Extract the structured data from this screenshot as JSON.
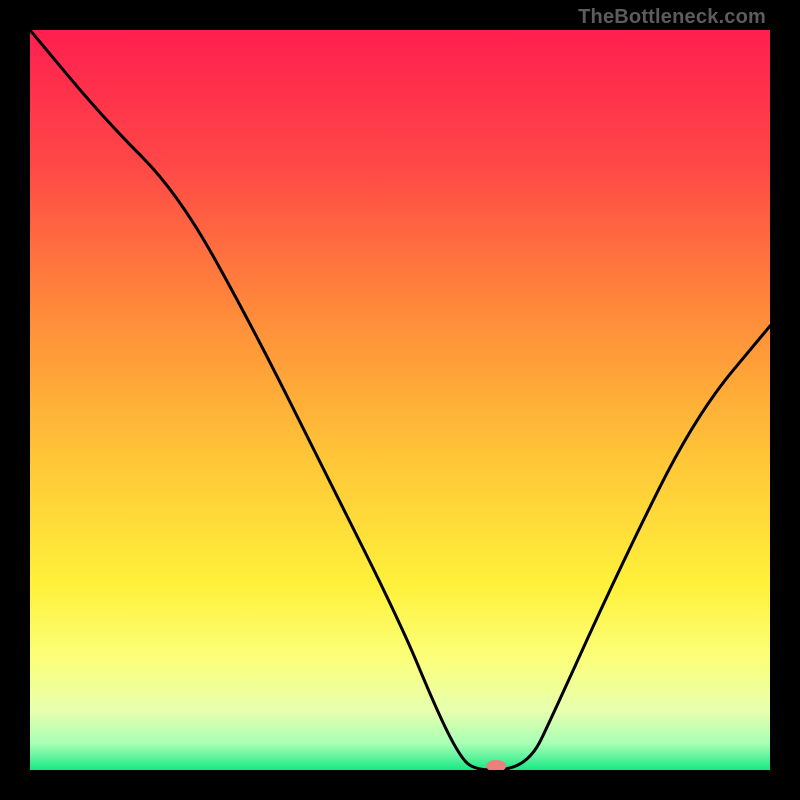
{
  "watermark": "TheBottleneck.com",
  "chart_data": {
    "type": "line",
    "title": "",
    "xlabel": "",
    "ylabel": "",
    "xlim": [
      0,
      100
    ],
    "ylim": [
      0,
      100
    ],
    "grid": false,
    "series": [
      {
        "name": "bottleneck-curve",
        "x": [
          0,
          10,
          20,
          30,
          40,
          50,
          55,
          58,
          60,
          65,
          68,
          70,
          80,
          90,
          100
        ],
        "values": [
          100,
          88,
          78,
          60,
          40,
          20,
          8,
          2,
          0,
          0,
          2,
          6,
          28,
          48,
          60
        ]
      }
    ],
    "marker": {
      "x": 63,
      "y": 0,
      "color": "#e8817b"
    },
    "background_gradient": {
      "stops": [
        {
          "pos": 0.0,
          "color": "#ff1f4f"
        },
        {
          "pos": 0.18,
          "color": "#ff4747"
        },
        {
          "pos": 0.38,
          "color": "#ff8a3a"
        },
        {
          "pos": 0.58,
          "color": "#ffc637"
        },
        {
          "pos": 0.75,
          "color": "#fff13b"
        },
        {
          "pos": 0.85,
          "color": "#fbff7a"
        },
        {
          "pos": 0.92,
          "color": "#e7ffae"
        },
        {
          "pos": 0.965,
          "color": "#a6ffb5"
        },
        {
          "pos": 1.0,
          "color": "#17e884"
        }
      ]
    }
  }
}
